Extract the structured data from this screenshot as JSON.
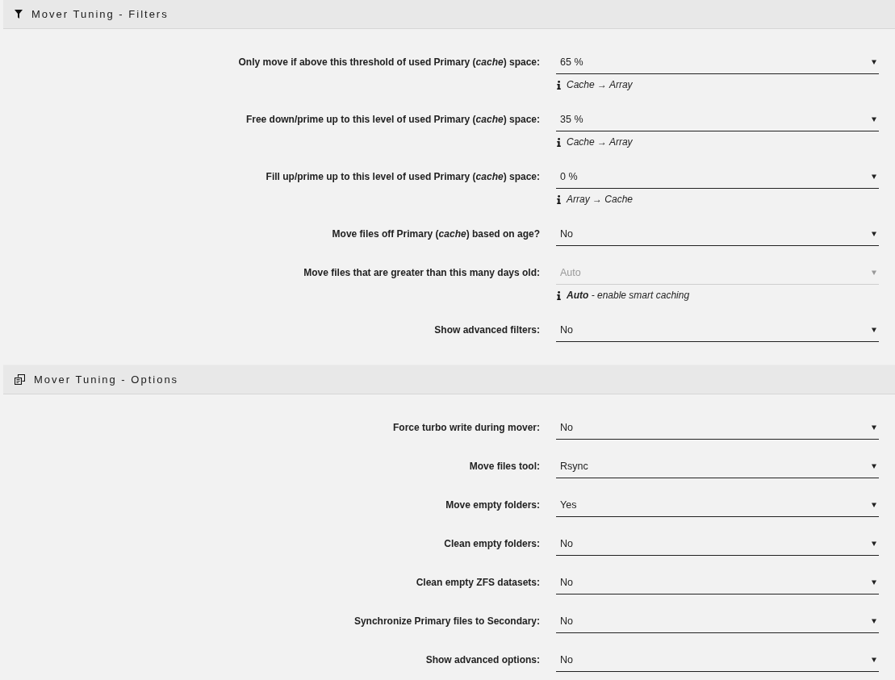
{
  "filters": {
    "title": "Mover Tuning - Filters",
    "rows": [
      {
        "label": "Only move if above this threshold of used Primary (*cache*) space:",
        "value": "65 %",
        "disabled": false,
        "hint": "Cache → Array"
      },
      {
        "label": "Free down/prime up to this level of used Primary (*cache*) space:",
        "value": "35 %",
        "disabled": false,
        "hint": "Cache → Array"
      },
      {
        "label": "Fill up/prime up to this level of used Primary (*cache*) space:",
        "value": "0 %",
        "disabled": false,
        "hint": "Array → Cache"
      },
      {
        "label": "Move files off Primary (*cache*) based on age?",
        "value": "No",
        "disabled": false
      },
      {
        "label": "Move files that are greater than this many days old:",
        "value": "Auto",
        "disabled": true,
        "hint": "**Auto** - *enable smart caching*"
      },
      {
        "label": "Show advanced filters:",
        "value": "No",
        "disabled": false
      }
    ]
  },
  "options": {
    "title": "Mover Tuning - Options",
    "rows": [
      {
        "label": "Force turbo write during mover:",
        "value": "No",
        "disabled": false
      },
      {
        "label": "Move files tool:",
        "value": "Rsync",
        "disabled": false
      },
      {
        "label": "Move empty folders:",
        "value": "Yes",
        "disabled": false
      },
      {
        "label": "Clean empty folders:",
        "value": "No",
        "disabled": false
      },
      {
        "label": "Clean empty ZFS datasets:",
        "value": "No",
        "disabled": false
      },
      {
        "label": "Synchronize Primary files to Secondary:",
        "value": "No",
        "disabled": false
      },
      {
        "label": "Show advanced options:",
        "value": "No",
        "disabled": false
      }
    ]
  }
}
